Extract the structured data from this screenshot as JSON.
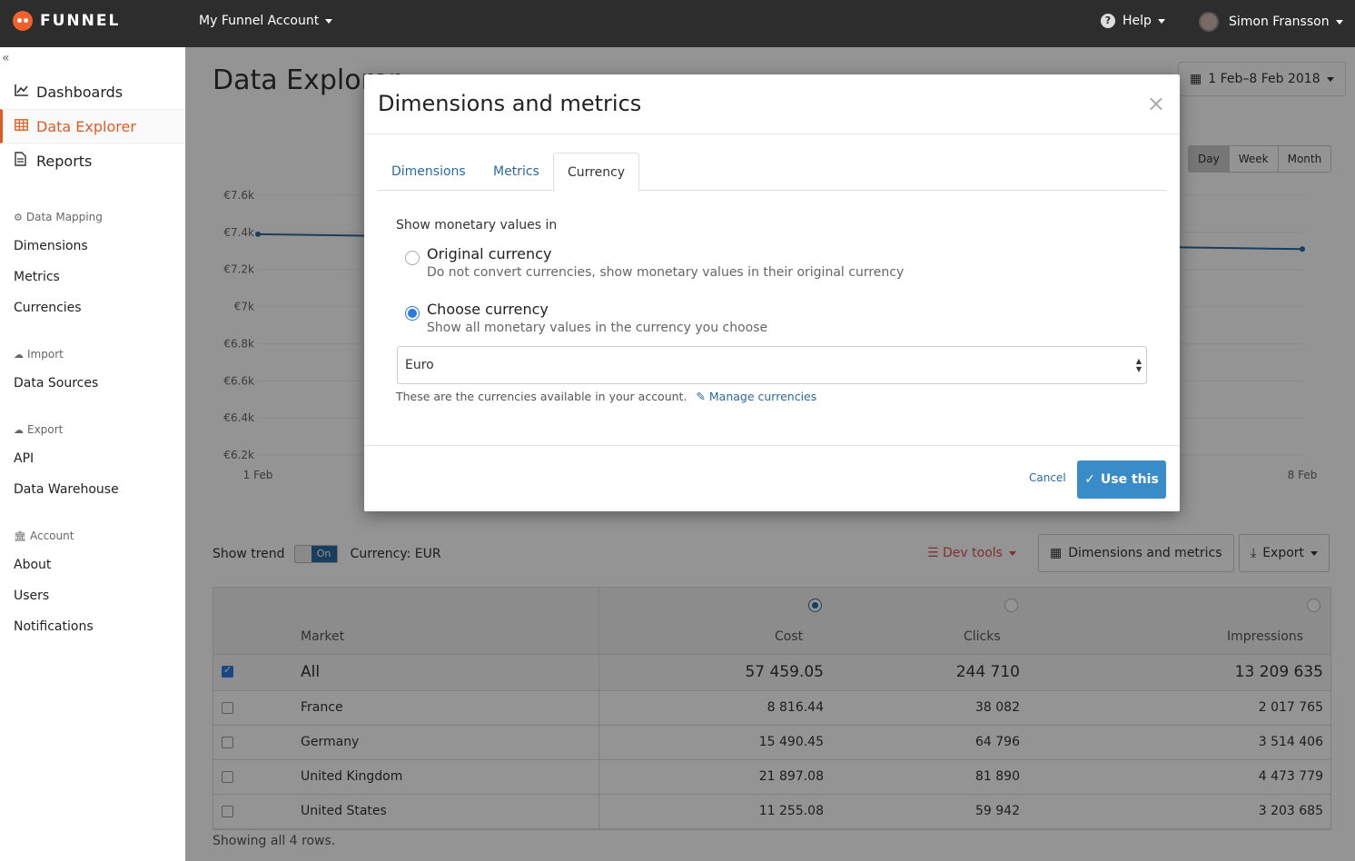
{
  "topbar": {
    "logo_text": "FUNNEL",
    "account": "My Funnel Account",
    "help": "Help",
    "help_glyph": "?",
    "user": "Simon Fransson"
  },
  "sidebar": {
    "collapse_glyph": "«",
    "main_items": [
      {
        "label": "Dashboards",
        "icon": "line-chart-icon",
        "active": false
      },
      {
        "label": "Data Explorer",
        "icon": "table-icon",
        "active": true
      },
      {
        "label": "Reports",
        "icon": "document-icon",
        "active": false
      }
    ],
    "sections": {
      "data_mapping": {
        "title": "Data Mapping",
        "items": [
          "Dimensions",
          "Metrics",
          "Currencies"
        ]
      },
      "import": {
        "title": "Import",
        "items": [
          "Data Sources"
        ]
      },
      "export": {
        "title": "Export",
        "items": [
          "API",
          "Data Warehouse"
        ]
      },
      "account": {
        "title": "Account",
        "items": [
          "About",
          "Users",
          "Notifications"
        ]
      }
    }
  },
  "main": {
    "title": "Data Explorer",
    "date_range": "1 Feb–8 Feb 2018",
    "periods": [
      "Day",
      "Week",
      "Month"
    ],
    "show_trend": "Show trend",
    "toggle": "On",
    "currency": "Currency: EUR",
    "dev_tools": "Dev tools",
    "dims_button": "Dimensions and metrics",
    "export_button": "Export",
    "showing": "Showing all 4 rows."
  },
  "chart_data": {
    "type": "line",
    "x": [
      "1 Feb",
      "8 Feb"
    ],
    "y_ticks": [
      "€7.6k",
      "€7.4k",
      "€7.2k",
      "€7k",
      "€6.8k",
      "€6.6k",
      "€6.4k",
      "€6.2k"
    ],
    "ylim": [
      6200,
      7600
    ],
    "series": [
      {
        "values": [
          7390,
          7310
        ]
      }
    ]
  },
  "table": {
    "columns": [
      "Market",
      "Cost",
      "Clicks",
      "Impressions"
    ],
    "selected_metric": "Cost",
    "total": {
      "label": "All",
      "cost": "57 459.05",
      "clicks": "244 710",
      "impressions": "13 209 635",
      "checked": true
    },
    "rows": [
      {
        "market": "France",
        "cost": "8 816.44",
        "clicks": "38 082",
        "impressions": "2 017 765"
      },
      {
        "market": "Germany",
        "cost": "15 490.45",
        "clicks": "64 796",
        "impressions": "3 514 406"
      },
      {
        "market": "United Kingdom",
        "cost": "21 897.08",
        "clicks": "81 890",
        "impressions": "4 473 779"
      },
      {
        "market": "United States",
        "cost": "11 255.08",
        "clicks": "59 942",
        "impressions": "3 203 685"
      }
    ]
  },
  "modal": {
    "title": "Dimensions and metrics",
    "close_glyph": "×",
    "tabs": [
      "Dimensions",
      "Metrics",
      "Currency"
    ],
    "active_tab": "Currency",
    "show_label": "Show monetary values in",
    "option_original": {
      "title": "Original currency",
      "desc": "Do not convert currencies, show monetary values in their original currency",
      "selected": false
    },
    "option_choose": {
      "title": "Choose currency",
      "desc": "Show all monetary values in the currency you choose",
      "selected": true
    },
    "select_value": "Euro",
    "help_text": "These are the currencies available in your account.",
    "manage_link": "Manage currencies",
    "cancel": "Cancel",
    "use_this": "Use this"
  }
}
